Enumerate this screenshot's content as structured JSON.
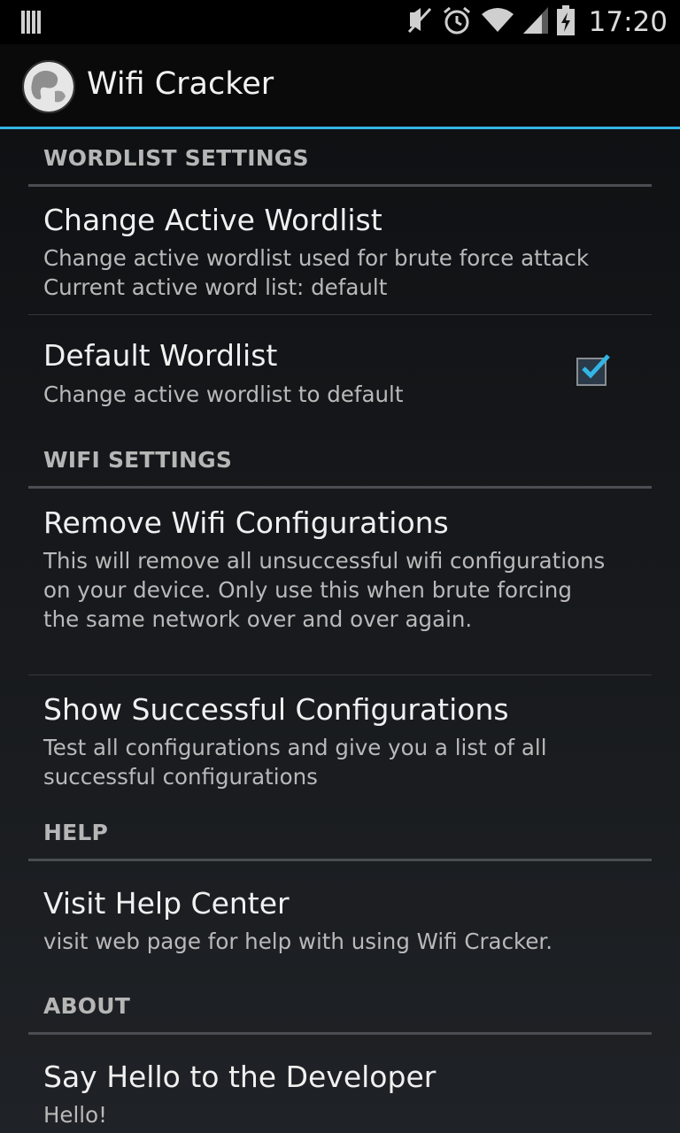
{
  "status_bar": {
    "time": "17:20",
    "icons": [
      "notification-icon",
      "mute-icon",
      "alarm-icon",
      "wifi-icon",
      "signal-icon",
      "battery-icon"
    ]
  },
  "action_bar": {
    "app_icon": "app-logo-icon",
    "title": "Wifi Cracker"
  },
  "categories": [
    {
      "label": "WORDLIST SETTINGS",
      "prefs": [
        {
          "title": "Change Active Wordlist",
          "summary": "Change active wordlist used for brute force attack Current active word list: default"
        },
        {
          "title": "Default Wordlist",
          "summary": "Change active wordlist to default",
          "checkbox": true
        }
      ]
    },
    {
      "label": "WIFI SETTINGS",
      "prefs": [
        {
          "title": "Remove Wifi Configurations",
          "summary": "This will remove all unsuccessful wifi configurations on your device. Only use this when brute forcing the same network over and over again."
        },
        {
          "title": "Show Successful Configurations",
          "summary": "Test all configurations and give you a list of all successful configurations"
        }
      ]
    },
    {
      "label": "HELP",
      "prefs": [
        {
          "title": "Visit Help Center",
          "summary": "visit web page for help with using Wifi Cracker."
        }
      ]
    },
    {
      "label": "ABOUT",
      "prefs": [
        {
          "title": "Say Hello to the Developer",
          "summary": "Hello!"
        }
      ]
    }
  ],
  "colors": {
    "accent": "#33b5e5",
    "checkmark": "#33b5e5"
  }
}
